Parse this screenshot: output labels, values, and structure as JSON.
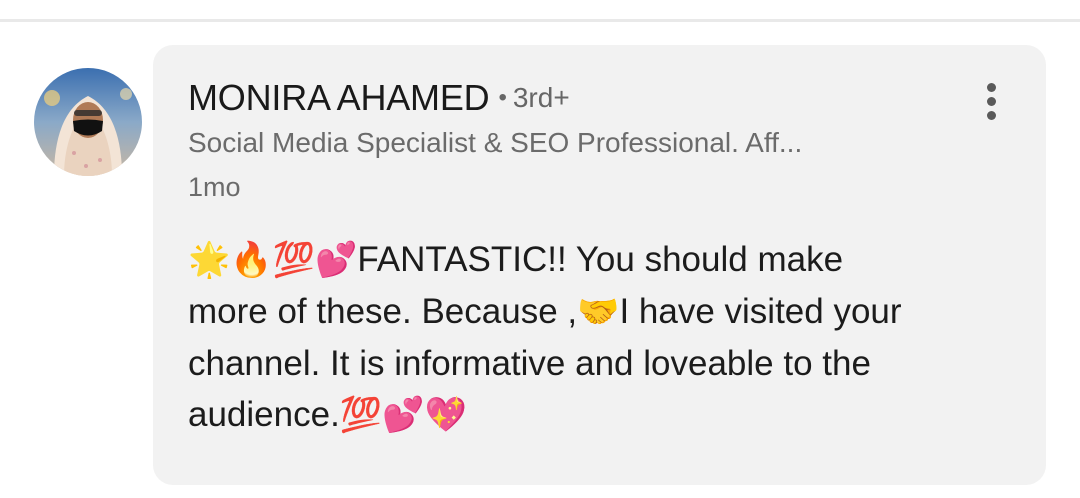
{
  "comment": {
    "author": {
      "name": "MONIRA AHAMED",
      "separator": "•",
      "connection_degree": "3rd+",
      "headline": "Social Media Specialist & SEO Professional. Aff...",
      "avatar_icon": "profile-photo"
    },
    "timestamp": "1mo",
    "more_menu_icon": "vertical-ellipsis-icon",
    "body": {
      "line1_emojis": "🌟🔥💯💕",
      "line1_text": "FANTASTIC!!  You should make",
      "line2_text_a": "more of these. Because ,",
      "line2_emoji": "🤝",
      "line2_text_b": "I have visited your",
      "line3_text": "channel. It is informative and loveable to the",
      "line4_text": "audience.",
      "line4_emojis": "💯💕💖"
    }
  },
  "colors": {
    "bubble_background": "#f2f2f2",
    "primary_text": "#1a1a1a",
    "secondary_text": "#6b6b6b",
    "divider": "#e9e9e9"
  }
}
